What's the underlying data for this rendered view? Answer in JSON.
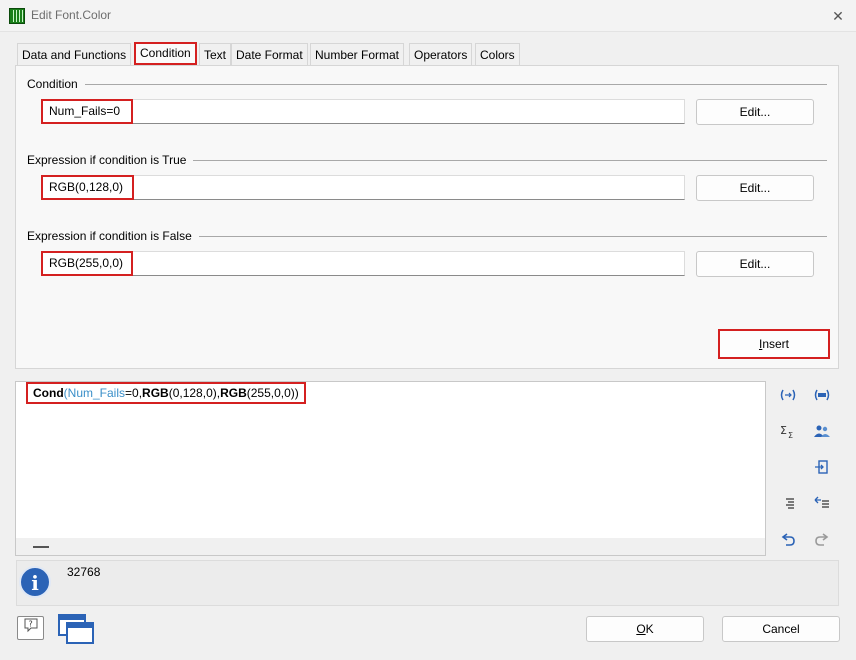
{
  "window": {
    "title": "Edit Font.Color",
    "close_symbol": "✕"
  },
  "tabs": [
    {
      "label": "Data and Functions",
      "active": false
    },
    {
      "label": "Condition",
      "active": true
    },
    {
      "label": "Text",
      "active": false
    },
    {
      "label": "Date Format",
      "active": false
    },
    {
      "label": "Number Format",
      "active": false
    },
    {
      "label": "Operators",
      "active": false
    },
    {
      "label": "Colors",
      "active": false
    }
  ],
  "condition": {
    "label": "Condition",
    "value": "Num_Fails=0",
    "edit_label": "Edit..."
  },
  "expr_true": {
    "label": "Expression if condition is True",
    "value": "RGB(0,128,0)",
    "edit_label": "Edit..."
  },
  "expr_false": {
    "label": "Expression if condition is False",
    "value": "RGB(255,0,0)",
    "edit_label": "Edit..."
  },
  "insert": {
    "label_underlined": "I",
    "label_rest": "nsert"
  },
  "formula": {
    "p1": "Cond",
    "p2": "(",
    "p3": "Num_Fails",
    "p4": "=0,",
    "p5": "RGB",
    "p6": "(0,128,0),",
    "p7": "RGB",
    "p8": "(255,0,0))"
  },
  "toolbar": {
    "icons": [
      "insert-parameters-icon",
      "insert-field-icon",
      "sum-icon",
      "users-icon",
      "insert-row-icon",
      "indent-icon",
      "outdent-icon",
      "undo-icon",
      "redo-icon"
    ]
  },
  "info": {
    "value": "32768"
  },
  "buttons": {
    "ok_underlined": "O",
    "ok_rest": "K",
    "cancel": "Cancel"
  },
  "colors": {
    "highlight_border": "#d42020",
    "variable_text": "#3a8fc9",
    "info_icon": "#2b63b6"
  }
}
